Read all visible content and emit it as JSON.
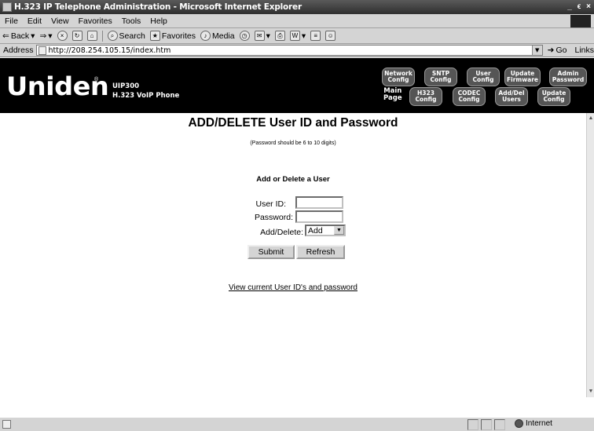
{
  "window": {
    "title": "H.323 IP Telephone Administration - Microsoft Internet Explorer",
    "controls": [
      "_",
      "ϵ",
      "×"
    ]
  },
  "menu": [
    "File",
    "Edit",
    "View",
    "Favorites",
    "Tools",
    "Help"
  ],
  "toolbar": {
    "back": "Back",
    "search": "Search",
    "favorites": "Favorites",
    "media": "Media"
  },
  "address": {
    "label": "Address",
    "url": "http://208.254.105.15/index.htm",
    "go": "Go",
    "links": "Links"
  },
  "banner": {
    "logo": "Uniden",
    "model_line1": "UIP300",
    "model_line2": "H.323 VoIP Phone",
    "main_page": "Main\nPage",
    "nav_top": [
      "Network\nConfig",
      "SNTP\nConfig",
      "User\nConfig",
      "Update\nFirmware",
      "Admin\nPassword"
    ],
    "nav_bottom": [
      "H323\nConfig",
      "CODEC\nConfig",
      "Add/Del\nUsers",
      "Update\nConfig"
    ]
  },
  "page": {
    "title": "ADD/DELETE User ID and Password",
    "note": "(Password should be 6 to 10 digits)",
    "section": "Add or Delete a User",
    "user_id_label": "User ID:",
    "password_label": "Password:",
    "action_label": "Add/Delete:",
    "action_value": "Add",
    "submit": "Submit",
    "refresh": "Refresh",
    "view_link": "View current User ID's and password"
  },
  "status": {
    "zone": "Internet"
  }
}
